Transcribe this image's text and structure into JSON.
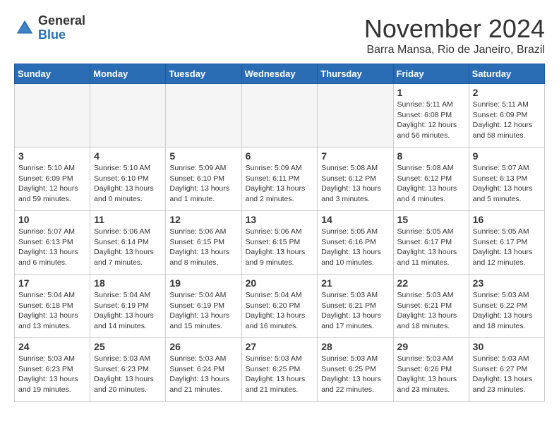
{
  "header": {
    "logo_line1": "General",
    "logo_line2": "Blue",
    "month": "November 2024",
    "location": "Barra Mansa, Rio de Janeiro, Brazil"
  },
  "days_of_week": [
    "Sunday",
    "Monday",
    "Tuesday",
    "Wednesday",
    "Thursday",
    "Friday",
    "Saturday"
  ],
  "weeks": [
    [
      {
        "day": "",
        "info": ""
      },
      {
        "day": "",
        "info": ""
      },
      {
        "day": "",
        "info": ""
      },
      {
        "day": "",
        "info": ""
      },
      {
        "day": "",
        "info": ""
      },
      {
        "day": "1",
        "info": "Sunrise: 5:11 AM\nSunset: 6:08 PM\nDaylight: 12 hours\nand 56 minutes."
      },
      {
        "day": "2",
        "info": "Sunrise: 5:11 AM\nSunset: 6:09 PM\nDaylight: 12 hours\nand 58 minutes."
      }
    ],
    [
      {
        "day": "3",
        "info": "Sunrise: 5:10 AM\nSunset: 6:09 PM\nDaylight: 12 hours\nand 59 minutes."
      },
      {
        "day": "4",
        "info": "Sunrise: 5:10 AM\nSunset: 6:10 PM\nDaylight: 13 hours\nand 0 minutes."
      },
      {
        "day": "5",
        "info": "Sunrise: 5:09 AM\nSunset: 6:10 PM\nDaylight: 13 hours\nand 1 minute."
      },
      {
        "day": "6",
        "info": "Sunrise: 5:09 AM\nSunset: 6:11 PM\nDaylight: 13 hours\nand 2 minutes."
      },
      {
        "day": "7",
        "info": "Sunrise: 5:08 AM\nSunset: 6:12 PM\nDaylight: 13 hours\nand 3 minutes."
      },
      {
        "day": "8",
        "info": "Sunrise: 5:08 AM\nSunset: 6:12 PM\nDaylight: 13 hours\nand 4 minutes."
      },
      {
        "day": "9",
        "info": "Sunrise: 5:07 AM\nSunset: 6:13 PM\nDaylight: 13 hours\nand 5 minutes."
      }
    ],
    [
      {
        "day": "10",
        "info": "Sunrise: 5:07 AM\nSunset: 6:13 PM\nDaylight: 13 hours\nand 6 minutes."
      },
      {
        "day": "11",
        "info": "Sunrise: 5:06 AM\nSunset: 6:14 PM\nDaylight: 13 hours\nand 7 minutes."
      },
      {
        "day": "12",
        "info": "Sunrise: 5:06 AM\nSunset: 6:15 PM\nDaylight: 13 hours\nand 8 minutes."
      },
      {
        "day": "13",
        "info": "Sunrise: 5:06 AM\nSunset: 6:15 PM\nDaylight: 13 hours\nand 9 minutes."
      },
      {
        "day": "14",
        "info": "Sunrise: 5:05 AM\nSunset: 6:16 PM\nDaylight: 13 hours\nand 10 minutes."
      },
      {
        "day": "15",
        "info": "Sunrise: 5:05 AM\nSunset: 6:17 PM\nDaylight: 13 hours\nand 11 minutes."
      },
      {
        "day": "16",
        "info": "Sunrise: 5:05 AM\nSunset: 6:17 PM\nDaylight: 13 hours\nand 12 minutes."
      }
    ],
    [
      {
        "day": "17",
        "info": "Sunrise: 5:04 AM\nSunset: 6:18 PM\nDaylight: 13 hours\nand 13 minutes."
      },
      {
        "day": "18",
        "info": "Sunrise: 5:04 AM\nSunset: 6:19 PM\nDaylight: 13 hours\nand 14 minutes."
      },
      {
        "day": "19",
        "info": "Sunrise: 5:04 AM\nSunset: 6:19 PM\nDaylight: 13 hours\nand 15 minutes."
      },
      {
        "day": "20",
        "info": "Sunrise: 5:04 AM\nSunset: 6:20 PM\nDaylight: 13 hours\nand 16 minutes."
      },
      {
        "day": "21",
        "info": "Sunrise: 5:03 AM\nSunset: 6:21 PM\nDaylight: 13 hours\nand 17 minutes."
      },
      {
        "day": "22",
        "info": "Sunrise: 5:03 AM\nSunset: 6:21 PM\nDaylight: 13 hours\nand 18 minutes."
      },
      {
        "day": "23",
        "info": "Sunrise: 5:03 AM\nSunset: 6:22 PM\nDaylight: 13 hours\nand 18 minutes."
      }
    ],
    [
      {
        "day": "24",
        "info": "Sunrise: 5:03 AM\nSunset: 6:23 PM\nDaylight: 13 hours\nand 19 minutes."
      },
      {
        "day": "25",
        "info": "Sunrise: 5:03 AM\nSunset: 6:23 PM\nDaylight: 13 hours\nand 20 minutes."
      },
      {
        "day": "26",
        "info": "Sunrise: 5:03 AM\nSunset: 6:24 PM\nDaylight: 13 hours\nand 21 minutes."
      },
      {
        "day": "27",
        "info": "Sunrise: 5:03 AM\nSunset: 6:25 PM\nDaylight: 13 hours\nand 21 minutes."
      },
      {
        "day": "28",
        "info": "Sunrise: 5:03 AM\nSunset: 6:25 PM\nDaylight: 13 hours\nand 22 minutes."
      },
      {
        "day": "29",
        "info": "Sunrise: 5:03 AM\nSunset: 6:26 PM\nDaylight: 13 hours\nand 23 minutes."
      },
      {
        "day": "30",
        "info": "Sunrise: 5:03 AM\nSunset: 6:27 PM\nDaylight: 13 hours\nand 23 minutes."
      }
    ]
  ]
}
